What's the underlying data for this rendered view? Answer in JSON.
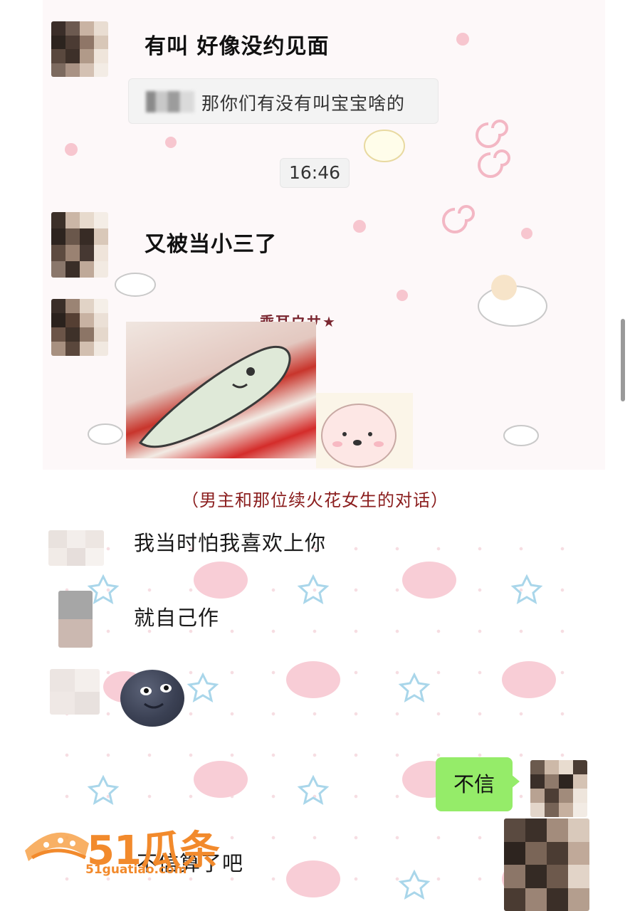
{
  "messages": {
    "m1": "有叫 好像没约见面",
    "quote_text": "那你们有没有叫宝宝啥的",
    "time": "16:46",
    "m2": "又被当小三了",
    "sticker_label": "乖耳ウサ★",
    "caption": "（男主和那位续火花女生的对话）",
    "m3": "我当时怕我喜欢上你",
    "m4": "就自己作",
    "m5_emoji": "new-moon-face",
    "outgoing": "不信",
    "m6": "不信算了吧"
  },
  "watermark": {
    "brand": "51瓜条",
    "url": "51guatiao.com"
  },
  "colors": {
    "outgoing_bubble": "#95ec69",
    "caption": "#8b1e1e",
    "watermark": "#f28a2c"
  }
}
